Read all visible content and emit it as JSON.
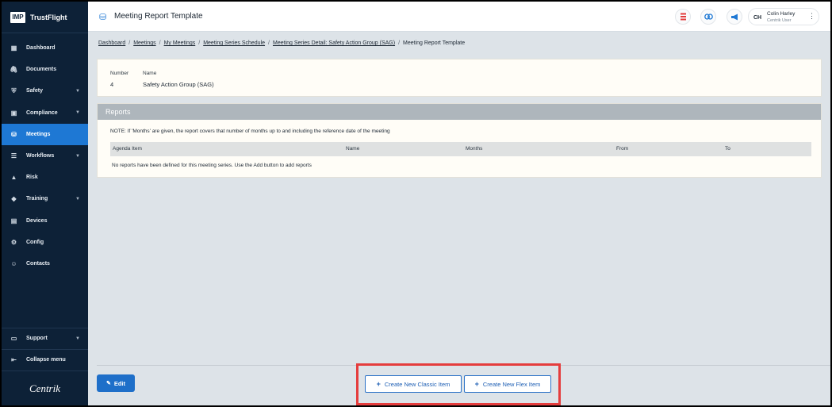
{
  "brand": {
    "logo": "IMP",
    "name": "TrustFlight"
  },
  "sidebar": {
    "items": [
      {
        "label": "Dashboard",
        "icon": "▦",
        "chevron": false,
        "active": false
      },
      {
        "label": "Documents",
        "icon": "🖇",
        "chevron": false,
        "active": false
      },
      {
        "label": "Safety",
        "icon": "⛨",
        "chevron": true,
        "active": false
      },
      {
        "label": "Compliance",
        "icon": "▣",
        "chevron": true,
        "active": false
      },
      {
        "label": "Meetings",
        "icon": "⛁",
        "chevron": false,
        "active": true
      },
      {
        "label": "Workflows",
        "icon": "☰",
        "chevron": true,
        "active": false
      },
      {
        "label": "Risk",
        "icon": "▲",
        "chevron": false,
        "active": false
      },
      {
        "label": "Training",
        "icon": "◆",
        "chevron": true,
        "active": false
      },
      {
        "label": "Devices",
        "icon": "▤",
        "chevron": false,
        "active": false
      },
      {
        "label": "Config",
        "icon": "⚙",
        "chevron": false,
        "active": false
      },
      {
        "label": "Contacts",
        "icon": "☺",
        "chevron": false,
        "active": false
      }
    ],
    "support": {
      "label": "Support",
      "icon": "▭"
    },
    "collapse": {
      "label": "Collapse menu",
      "icon": "⇤"
    },
    "footer_logo": "Centrik"
  },
  "header": {
    "title": "Meeting Report Template",
    "icon": "⛁",
    "user": {
      "initials": "CH",
      "name": "Colin Harley",
      "role": "Centrik User"
    }
  },
  "breadcrumb": {
    "links": [
      "Dashboard",
      "Meetings",
      "My Meetings",
      "Meeting Series Schedule",
      "Meeting Series Detail: Safety Action Group (SAG)"
    ],
    "current": "Meeting Report Template",
    "separator": "/"
  },
  "info": {
    "number_label": "Number",
    "number_value": "4",
    "name_label": "Name",
    "name_value": "Safety Action Group (SAG)"
  },
  "reports": {
    "title": "Reports",
    "note": "NOTE: If 'Months' are given, the report covers that number of months up to and including the reference date of the meeting",
    "columns": [
      "Agenda Item",
      "Name",
      "Months",
      "From",
      "To"
    ],
    "empty_message": "No reports have been defined for this meeting series. Use the Add button to add reports"
  },
  "footer": {
    "edit_label": "Edit",
    "create_classic_label": "Create New Classic Item",
    "create_flex_label": "Create New Flex Item"
  },
  "colors": {
    "sidebar_bg": "#0d2137",
    "active": "#1e78d4",
    "highlight": "#e53d3d"
  }
}
